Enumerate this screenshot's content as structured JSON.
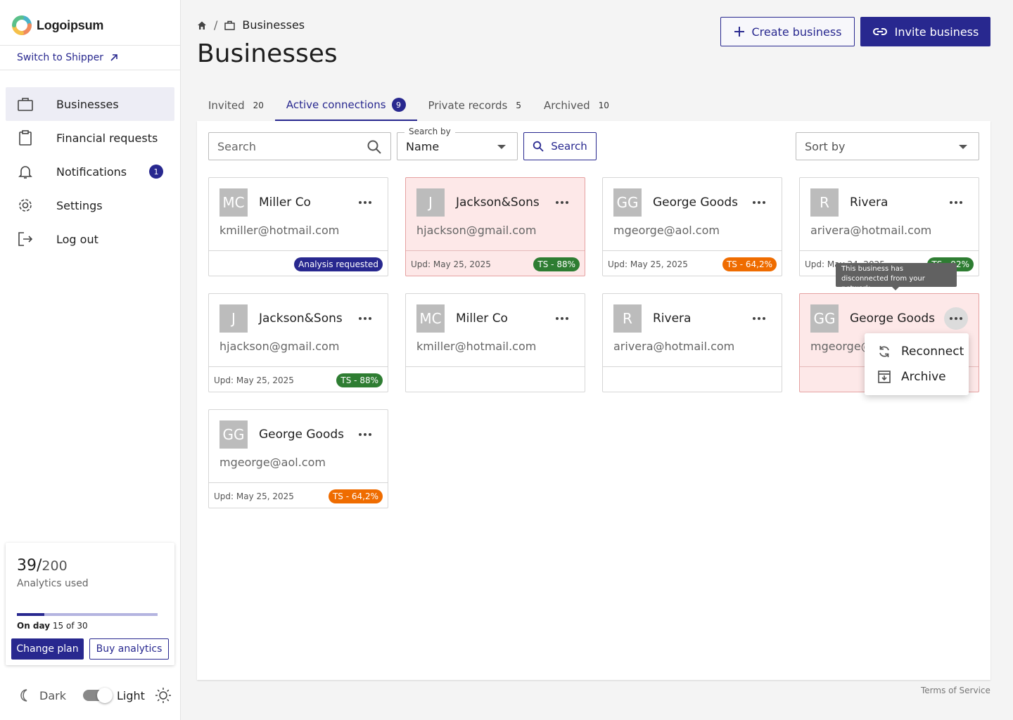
{
  "brand": {
    "name": "Logoipsum"
  },
  "sidebar": {
    "switch_label": "Switch to Shipper",
    "items": [
      {
        "label": "Businesses",
        "icon": "briefcase-icon",
        "active": true
      },
      {
        "label": "Financial requests",
        "icon": "clipboard-icon"
      },
      {
        "label": "Notifications",
        "icon": "bell-icon",
        "badge": "1"
      },
      {
        "label": "Settings",
        "icon": "gear-icon"
      },
      {
        "label": "Log out",
        "icon": "logout-icon"
      }
    ],
    "usage": {
      "used": "39/",
      "total": "200",
      "caption": "Analytics used",
      "progress": 0.195,
      "day_prefix": "On day",
      "day_value": "15 of 30",
      "change_plan": "Change plan",
      "buy_analytics": "Buy analytics"
    },
    "theme": {
      "dark": "Dark",
      "light": "Light",
      "selected": "Light"
    }
  },
  "header": {
    "breadcrumb": "Businesses",
    "title": "Businesses",
    "create_label": "Create business",
    "invite_label": "Invite business"
  },
  "tabs": [
    {
      "label": "Invited",
      "count": "20"
    },
    {
      "label": "Active connections",
      "count": "9",
      "active": true
    },
    {
      "label": "Private records",
      "count": "5"
    },
    {
      "label": "Archived",
      "count": "10"
    }
  ],
  "filters": {
    "search_placeholder": "Search",
    "search_by_label": "Search by",
    "search_by_value": "Name",
    "search_button": "Search",
    "sort_placeholder": "Sort by"
  },
  "cards": [
    {
      "initials": "MC",
      "name": "Miller Co",
      "email": "kmiller@hotmail.com",
      "updated": "",
      "tag": "Analysis requested",
      "tag_color": "navy",
      "alert": false
    },
    {
      "initials": "J",
      "name": "Jackson&Sons",
      "email": "hjackson@gmail.com",
      "updated": "Upd: May 25, 2025",
      "tag": "TS - 88%",
      "tag_color": "green",
      "alert": true
    },
    {
      "initials": "GG",
      "name": "George Goods",
      "email": "mgeorge@aol.com",
      "updated": "Upd: May 25, 2025",
      "tag": "TS - 64,2%",
      "tag_color": "orange",
      "alert": false
    },
    {
      "initials": "R",
      "name": "Rivera",
      "email": "arivera@hotmail.com",
      "updated": "Upd: May 24, 2025",
      "tag": "TS - 92%",
      "tag_color": "green",
      "alert": false
    },
    {
      "initials": "J",
      "name": "Jackson&Sons",
      "email": "hjackson@gmail.com",
      "updated": "Upd: May 25, 2025",
      "tag": "TS - 88%",
      "tag_color": "green",
      "alert": false
    },
    {
      "initials": "MC",
      "name": "Miller Co",
      "email": "kmiller@hotmail.com",
      "updated": "",
      "tag": "",
      "tag_color": "",
      "alert": false
    },
    {
      "initials": "R",
      "name": "Rivera",
      "email": "arivera@hotmail.com",
      "updated": "",
      "tag": "",
      "tag_color": "",
      "alert": false
    },
    {
      "initials": "GG",
      "name": "George Goods",
      "email": "mgeorge@aol.com",
      "updated": "",
      "tag": "",
      "tag_color": "",
      "alert": true,
      "menu_open": true
    },
    {
      "initials": "GG",
      "name": "George Goods",
      "email": "mgeorge@aol.com",
      "updated": "Upd: May 25, 2025",
      "tag": "TS - 64,2%",
      "tag_color": "orange",
      "alert": false
    }
  ],
  "tooltip": {
    "text": "This business has disconnected from your network"
  },
  "menu": {
    "reconnect": "Reconnect",
    "archive": "Archive"
  },
  "colors": {
    "primary": "#28288f",
    "alert_bg": "#fde8e8",
    "green": "#2e7d32",
    "orange": "#ef6c00"
  },
  "footer": {
    "terms": "Terms of Service"
  }
}
